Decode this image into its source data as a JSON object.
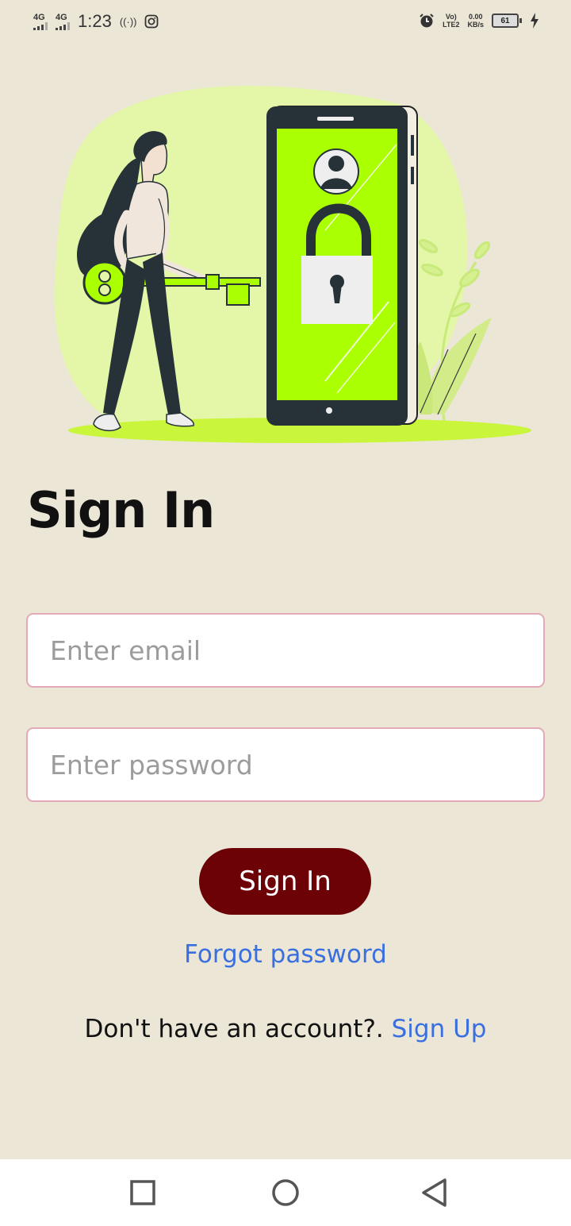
{
  "status_bar": {
    "sim1": "4G",
    "sim2": "4G",
    "time": "1:23",
    "volte": "Vo)",
    "lte": "LTE2",
    "speed": "0.00",
    "speed_unit": "KB/s",
    "battery": "61"
  },
  "title": "Sign In",
  "email": {
    "placeholder": "Enter email",
    "value": ""
  },
  "password": {
    "placeholder": "Enter password",
    "value": ""
  },
  "signin_button": "Sign In",
  "forgot_password": "Forgot password",
  "signup_prompt": "Don't have an account?.",
  "signup_link": "Sign Up",
  "colors": {
    "background": "#ebe6d6",
    "primary_button": "#6c0205",
    "link": "#3a6fe0",
    "input_border": "#e4a8b6",
    "accent_green": "#aaff00"
  },
  "navbar": {
    "icons": [
      "square-icon",
      "circle-home-icon",
      "triangle-back-icon"
    ]
  }
}
